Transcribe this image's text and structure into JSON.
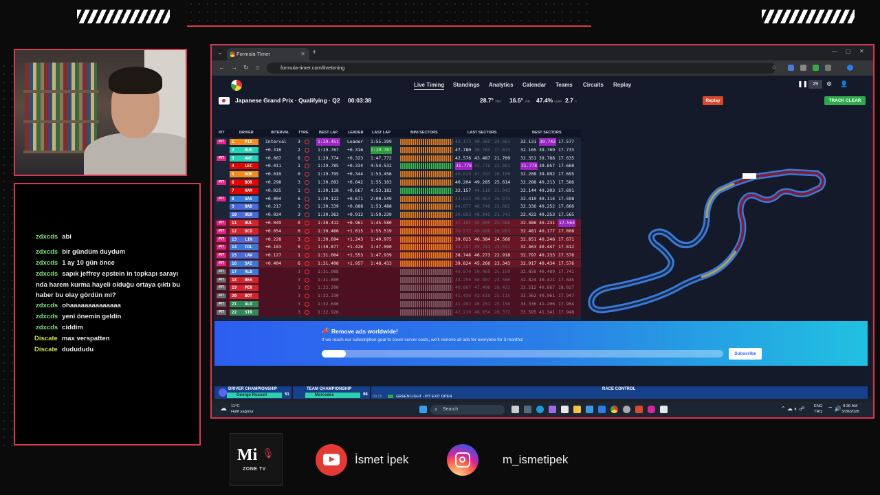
{
  "overlay": {
    "chat": [
      {
        "user": "zdxcds",
        "msg": "abi",
        "alt": false
      },
      {
        "user": "zdxcds",
        "msg": "bir gündüm duydum",
        "alt": false
      },
      {
        "user": "zdxcds",
        "msg": "1 ay 10 gün önce",
        "alt": false
      },
      {
        "user": "zdxcds",
        "msg": "sapık jeffrey epstein in topkapı sarayı nda harem kurma hayeli olduğu ortaya çıktı bu haber bu olay gördün mi?",
        "alt": false
      },
      {
        "user": "zdxcds",
        "msg": "ohaaaaaaaaaaaaaa",
        "alt": false
      },
      {
        "user": "zdxcds",
        "msg": "yeni önemin geldin",
        "alt": false
      },
      {
        "user": "zdxcds",
        "msg": "ciddim",
        "alt": false
      },
      {
        "user": "Discate",
        "msg": "max verspatten",
        "alt": true
      },
      {
        "user": "Discate",
        "msg": "dudududu",
        "alt": true
      }
    ],
    "logo_big": "Mi",
    "logo_small": "ZONE TV",
    "youtube_name": "İsmet İpek",
    "instagram_name": "m_ismetipek"
  },
  "browser": {
    "tab_title": "Formula-Timer",
    "url": "formula-timer.com/livetiming"
  },
  "app": {
    "nav": [
      "Live Timing",
      "Standings",
      "Analytics",
      "Calendar",
      "Teams",
      "Circuits",
      "Replay"
    ],
    "session_title": "Japanese Grand Prix · Qualifying · Q2",
    "clock": "00:03:38",
    "weather": [
      {
        "value": "28.7°",
        "unit": "TRC"
      },
      {
        "value": "16.5°",
        "unit": "AIR"
      },
      {
        "value": "47.4%",
        "unit": "HUM"
      },
      {
        "value": "2.7",
        "unit": "≡"
      }
    ],
    "viewer_count": "29",
    "replay_btn": "Replay",
    "track_clear_btn": "TRACK CLEAR",
    "table_headers": [
      "PIT",
      "DRIVER",
      "INTERVAL",
      "TYRE",
      "BEST LAP",
      "LEADER",
      "LAST LAP",
      "MINI SECTORS",
      "LAST SECTORS",
      "BEST SECTORS"
    ],
    "rows": [
      {
        "pit": "PIT",
        "pos": "1",
        "code": "PIA",
        "team": "#f28b1e",
        "interval": "Interval",
        "laps": "3",
        "tyre": "s",
        "best": "1:29.451",
        "best_p": true,
        "leader": "Leader",
        "last": "1:55.399",
        "last_g": false,
        "minis": "o",
        "ls": [
          "42.173",
          "40.369",
          "24.061"
        ],
        "ls_cls": [
          "d",
          "d",
          "d"
        ],
        "bs": [
          "32.131",
          "39.743",
          "17.577"
        ],
        "bs_cls": [
          "",
          "p",
          ""
        ],
        "style": ""
      },
      {
        "pit": "",
        "pos": "2",
        "code": "RUS",
        "team": "#27d2b4",
        "interval": "+0.316",
        "laps": "2",
        "tyre": "s",
        "best": "1:29.767",
        "best_p": false,
        "leader": "+0.316",
        "last": "1:29.767",
        "last_g": true,
        "minis": "o",
        "ls": [
          "47.780",
          "39.769",
          "17.833"
        ],
        "ls_cls": [
          "",
          "d",
          "d"
        ],
        "bs": [
          "32.165",
          "39.769",
          "17.733"
        ],
        "bs_cls": [
          "",
          "",
          ""
        ],
        "style": ""
      },
      {
        "pit": "PIT",
        "pos": "3",
        "code": "ANT",
        "team": "#27d2b4",
        "interval": "+0.007",
        "laps": "6",
        "tyre": "s",
        "best": "1:29.774",
        "best_p": false,
        "leader": "+0.323",
        "last": "1:47.772",
        "last_g": false,
        "minis": "o",
        "ls": [
          "42.576",
          "43.487",
          "21.709"
        ],
        "ls_cls": [
          "",
          "",
          ""
        ],
        "bs": [
          "32.351",
          "39.788",
          "17.635"
        ],
        "bs_cls": [
          "",
          "",
          ""
        ],
        "style": ""
      },
      {
        "pit": "",
        "pos": "4",
        "code": "LEC",
        "team": "#e10600",
        "interval": "+0.011",
        "laps": "1",
        "tyre": "s",
        "best": "1:29.785",
        "best_p": false,
        "leader": "+0.334",
        "last": "4:54.532",
        "last_g": false,
        "minis": "g",
        "ls": [
          "31.778",
          "43.778",
          "22.851"
        ],
        "ls_cls": [
          "p",
          "d",
          "d"
        ],
        "bs": [
          "31.778",
          "39.857",
          "17.668"
        ],
        "bs_cls": [
          "p",
          "",
          ""
        ],
        "style": ""
      },
      {
        "pit": "",
        "pos": "5",
        "code": "NOR",
        "team": "#f28b1e",
        "interval": "+0.010",
        "laps": "0",
        "tyre": "s",
        "best": "1:29.795",
        "best_p": false,
        "leader": "+0.344",
        "last": "1:53.456",
        "last_g": false,
        "minis": "o",
        "ls": [
          "40.019",
          "47.337",
          "26.100"
        ],
        "ls_cls": [
          "d",
          "d",
          "d"
        ],
        "bs": [
          "32.208",
          "39.892",
          "17.695"
        ],
        "bs_cls": [
          "",
          "",
          ""
        ],
        "style": ""
      },
      {
        "pit": "PIT",
        "pos": "6",
        "code": "BOR",
        "team": "#e10600",
        "interval": "+0.298",
        "laps": "3",
        "tyre": "s",
        "best": "1:30.093",
        "best_p": false,
        "leader": "+0.642",
        "last": "1:55.103",
        "last_g": false,
        "minis": "o",
        "ls": [
          "40.204",
          "49.285",
          "25.614"
        ],
        "ls_cls": [
          "",
          "",
          ""
        ],
        "bs": [
          "32.288",
          "40.213",
          "17.586"
        ],
        "bs_cls": [
          "",
          "",
          ""
        ],
        "style": ""
      },
      {
        "pit": "",
        "pos": "7",
        "code": "HAM",
        "team": "#e10600",
        "interval": "+0.025",
        "laps": "1",
        "tyre": "s",
        "best": "1:30.118",
        "best_p": false,
        "leader": "+0.667",
        "last": "4:53.182",
        "last_g": false,
        "minis": "g",
        "ls": [
          "32.157",
          "44.118",
          "21.043"
        ],
        "ls_cls": [
          "",
          "d",
          "d"
        ],
        "bs": [
          "32.144",
          "40.203",
          "17.691"
        ],
        "bs_cls": [
          "",
          "",
          ""
        ],
        "style": ""
      },
      {
        "pit": "PIT",
        "pos": "8",
        "code": "GAS",
        "team": "#3a7ad6",
        "interval": "+0.004",
        "laps": "6",
        "tyre": "s",
        "best": "1:30.122",
        "best_p": false,
        "leader": "+0.671",
        "last": "2:00.549",
        "last_g": false,
        "minis": "o",
        "ls": [
          "43.622",
          "49.854",
          "26.973"
        ],
        "ls_cls": [
          "d",
          "d",
          "d"
        ],
        "bs": [
          "32.410",
          "40.114",
          "17.598"
        ],
        "bs_cls": [
          "",
          "",
          ""
        ],
        "style": ""
      },
      {
        "pit": "",
        "pos": "9",
        "code": "HAD",
        "team": "#4a6ad8",
        "interval": "+0.217",
        "laps": "3",
        "tyre": "s",
        "best": "1:30.339",
        "best_p": false,
        "leader": "+0.888",
        "last": "1:53.488",
        "last_g": false,
        "minis": "o",
        "ls": [
          "44.077",
          "46.749",
          "22.662"
        ],
        "ls_cls": [
          "d",
          "d",
          "d"
        ],
        "bs": [
          "32.336",
          "40.252",
          "17.666"
        ],
        "bs_cls": [
          "",
          "",
          ""
        ],
        "style": ""
      },
      {
        "pit": "",
        "pos": "10",
        "code": "VER",
        "team": "#4a6ad8",
        "interval": "+0.024",
        "laps": "3",
        "tyre": "s",
        "best": "1:30.363",
        "best_p": false,
        "leader": "+0.912",
        "last": "1:50.239",
        "last_g": false,
        "minis": "o",
        "ls": [
          "39.853",
          "48.045",
          "21.741"
        ],
        "ls_cls": [
          "d",
          "d",
          "d"
        ],
        "bs": [
          "32.423",
          "40.253",
          "17.565"
        ],
        "bs_cls": [
          "",
          "",
          ""
        ],
        "style": ""
      },
      {
        "pit": "PIT",
        "pos": "11",
        "code": "HUL",
        "team": "#d0252f",
        "interval": "+0.049",
        "laps": "0",
        "tyre": "s",
        "best": "1:30.412",
        "best_p": false,
        "leader": "+0.961",
        "last": "1:45.580",
        "last_g": false,
        "minis": "o",
        "ls": [
          "37.184",
          "45.605",
          "23.388"
        ],
        "ls_cls": [
          "d",
          "d",
          "d"
        ],
        "bs": [
          "32.486",
          "40.231",
          "17.564"
        ],
        "bs_cls": [
          "",
          "",
          "p"
        ],
        "style": "red"
      },
      {
        "pit": "PIT",
        "pos": "12",
        "code": "OCO",
        "team": "#d0252f",
        "interval": "+0.054",
        "laps": "0",
        "tyre": "s",
        "best": "1:30.466",
        "best_p": false,
        "leader": "+1.015",
        "last": "1:55.519",
        "last_g": false,
        "minis": "o",
        "ls": [
          "39.537",
          "49.608",
          "26.283"
        ],
        "ls_cls": [
          "d",
          "d",
          "d"
        ],
        "bs": [
          "32.481",
          "40.177",
          "17.808"
        ],
        "bs_cls": [
          "",
          "",
          ""
        ],
        "style": "red"
      },
      {
        "pit": "PIT",
        "pos": "13",
        "code": "LIN",
        "team": "#4a6ad8",
        "interval": "+0.228",
        "laps": "3",
        "tyre": "s",
        "best": "1:30.694",
        "best_p": false,
        "leader": "+1.243",
        "last": "1:49.975",
        "last_g": false,
        "minis": "o",
        "ls": [
          "39.025",
          "46.384",
          "24.566"
        ],
        "ls_cls": [
          "",
          "",
          ""
        ],
        "bs": [
          "32.651",
          "40.248",
          "17.671"
        ],
        "bs_cls": [
          "",
          "",
          ""
        ],
        "style": "red"
      },
      {
        "pit": "PIT",
        "pos": "14",
        "code": "COL",
        "team": "#3a7ad6",
        "interval": "+0.183",
        "laps": "0",
        "tyre": "s",
        "best": "1:30.877",
        "best_p": false,
        "leader": "+1.426",
        "last": "1:47.090",
        "last_g": false,
        "minis": "o",
        "ls": [
          "38.297",
          "45.242",
          "23.551"
        ],
        "ls_cls": [
          "d",
          "d",
          "d"
        ],
        "bs": [
          "32.463",
          "40.447",
          "17.812"
        ],
        "bs_cls": [
          "",
          "",
          ""
        ],
        "style": "red"
      },
      {
        "pit": "PIT",
        "pos": "15",
        "code": "LAW",
        "team": "#4a6ad8",
        "interval": "+0.127",
        "laps": "1",
        "tyre": "s",
        "best": "1:31.004",
        "best_p": false,
        "leader": "+1.553",
        "last": "1:47.939",
        "last_g": false,
        "minis": "o",
        "ls": [
          "38.748",
          "46.273",
          "22.918"
        ],
        "ls_cls": [
          "",
          "",
          ""
        ],
        "bs": [
          "32.797",
          "40.233",
          "17.576"
        ],
        "bs_cls": [
          "",
          "",
          ""
        ],
        "style": "red"
      },
      {
        "pit": "PIT",
        "pos": "16",
        "code": "SAI",
        "team": "#3a7ad6",
        "interval": "+0.404",
        "laps": "6",
        "tyre": "s",
        "best": "1:31.408",
        "best_p": false,
        "leader": "+1.957",
        "last": "1:48.433",
        "last_g": false,
        "minis": "o",
        "ls": [
          "39.824",
          "45.266",
          "23.343"
        ],
        "ls_cls": [
          "",
          "",
          ""
        ],
        "bs": [
          "32.917",
          "40.434",
          "17.576"
        ],
        "bs_cls": [
          "",
          "",
          ""
        ],
        "style": "red"
      },
      {
        "pit": "PIT",
        "pos": "17",
        "code": "ALB",
        "team": "#3a7ad6",
        "interval": "",
        "laps": "3",
        "tyre": "s",
        "best": "1:31.088",
        "best_p": false,
        "leader": "",
        "last": "",
        "last_g": false,
        "minis": "dim",
        "ls": [
          "40.870",
          "50.469",
          "25.150"
        ],
        "ls_cls": [
          "d",
          "d",
          "d"
        ],
        "bs": [
          "32.858",
          "40.489",
          "17.741"
        ],
        "bs_cls": [
          "",
          "",
          ""
        ],
        "style": "dim"
      },
      {
        "pit": "PIT",
        "pos": "18",
        "code": "BEA",
        "team": "#d0252f",
        "interval": "",
        "laps": "3",
        "tyre": "s",
        "best": "1:31.890",
        "best_p": false,
        "leader": "",
        "last": "",
        "last_g": false,
        "minis": "dim",
        "ls": [
          "44.250",
          "50.807",
          "24.566"
        ],
        "ls_cls": [
          "d",
          "d",
          "d"
        ],
        "bs": [
          "32.824",
          "40.421",
          "17.845"
        ],
        "bs_cls": [
          "",
          "",
          ""
        ],
        "style": "dim"
      },
      {
        "pit": "PIT",
        "pos": "19",
        "code": "PER",
        "team": "#d0252f",
        "interval": "",
        "laps": "3",
        "tyre": "s",
        "best": "1:32.206",
        "best_p": false,
        "leader": "",
        "last": "",
        "last_g": false,
        "minis": "dim",
        "ls": [
          "40.887",
          "47.496",
          "26.423"
        ],
        "ls_cls": [
          "d",
          "d",
          "d"
        ],
        "bs": [
          "33.512",
          "40.667",
          "18.027"
        ],
        "bs_cls": [
          "",
          "",
          ""
        ],
        "style": "dim"
      },
      {
        "pit": "PIT",
        "pos": "20",
        "code": "BOT",
        "team": "#d0252f",
        "interval": "",
        "laps": "3",
        "tyre": "s",
        "best": "1:32.330",
        "best_p": false,
        "leader": "",
        "last": "",
        "last_g": false,
        "minis": "dim",
        "ls": [
          "41.436",
          "42.619",
          "25.115"
        ],
        "ls_cls": [
          "d",
          "d",
          "d"
        ],
        "bs": [
          "33.362",
          "40.961",
          "17.947"
        ],
        "bs_cls": [
          "",
          "",
          ""
        ],
        "style": "dim"
      },
      {
        "pit": "PIT",
        "pos": "21",
        "code": "ALO",
        "team": "#2e8b57",
        "interval": "",
        "laps": "3",
        "tyre": "s",
        "best": "1:32.646",
        "best_p": false,
        "leader": "",
        "last": "",
        "last_g": false,
        "minis": "dim",
        "ls": [
          "41.492",
          "46.251",
          "25.156"
        ],
        "ls_cls": [
          "d",
          "d",
          "d"
        ],
        "bs": [
          "33.336",
          "41.206",
          "17.904"
        ],
        "bs_cls": [
          "",
          "",
          ""
        ],
        "style": "dim"
      },
      {
        "pit": "PIT",
        "pos": "22",
        "code": "STR",
        "team": "#2e8b57",
        "interval": "",
        "laps": "3",
        "tyre": "s",
        "best": "1:32.920",
        "best_p": false,
        "leader": "",
        "last": "",
        "last_g": false,
        "minis": "dim",
        "ls": [
          "42.219",
          "48.854",
          "26.372"
        ],
        "ls_cls": [
          "d",
          "d",
          "d"
        ],
        "bs": [
          "33.595",
          "41.341",
          "17.948"
        ],
        "bs_cls": [
          "",
          "",
          ""
        ],
        "style": "dim"
      }
    ],
    "ad": {
      "title": "Remove ads worldwide!",
      "text": "If we reach our subscription goal to cover server costs, we'll remove all ads for everyone for 3 months!",
      "progress": 0.06,
      "subscribe": "Subscribe"
    },
    "bottom": {
      "driver_champ": "DRIVER CHAMPIONSHIP",
      "driver_row": "George Russell",
      "driver_pts": "51",
      "team_champ": "TEAM CHAMPIONSHIP",
      "team_row": "Mercedes",
      "team_pts": "98",
      "race_control": "RACE CONTROL",
      "rc_time": "09:25",
      "rc_msg": "GREEN LIGHT - PIT EXIT OPEN"
    }
  },
  "taskbar": {
    "temp": "11°C",
    "weather": "Hafif yağmur",
    "search": "Search",
    "lang1": "ENG",
    "lang2": "TRQ",
    "time": "9:36 AM",
    "date": "3/28/2026"
  },
  "colors": {
    "accent_red": "#d93a4f",
    "purple": "#9b26c4",
    "green": "#2e9a3a"
  }
}
